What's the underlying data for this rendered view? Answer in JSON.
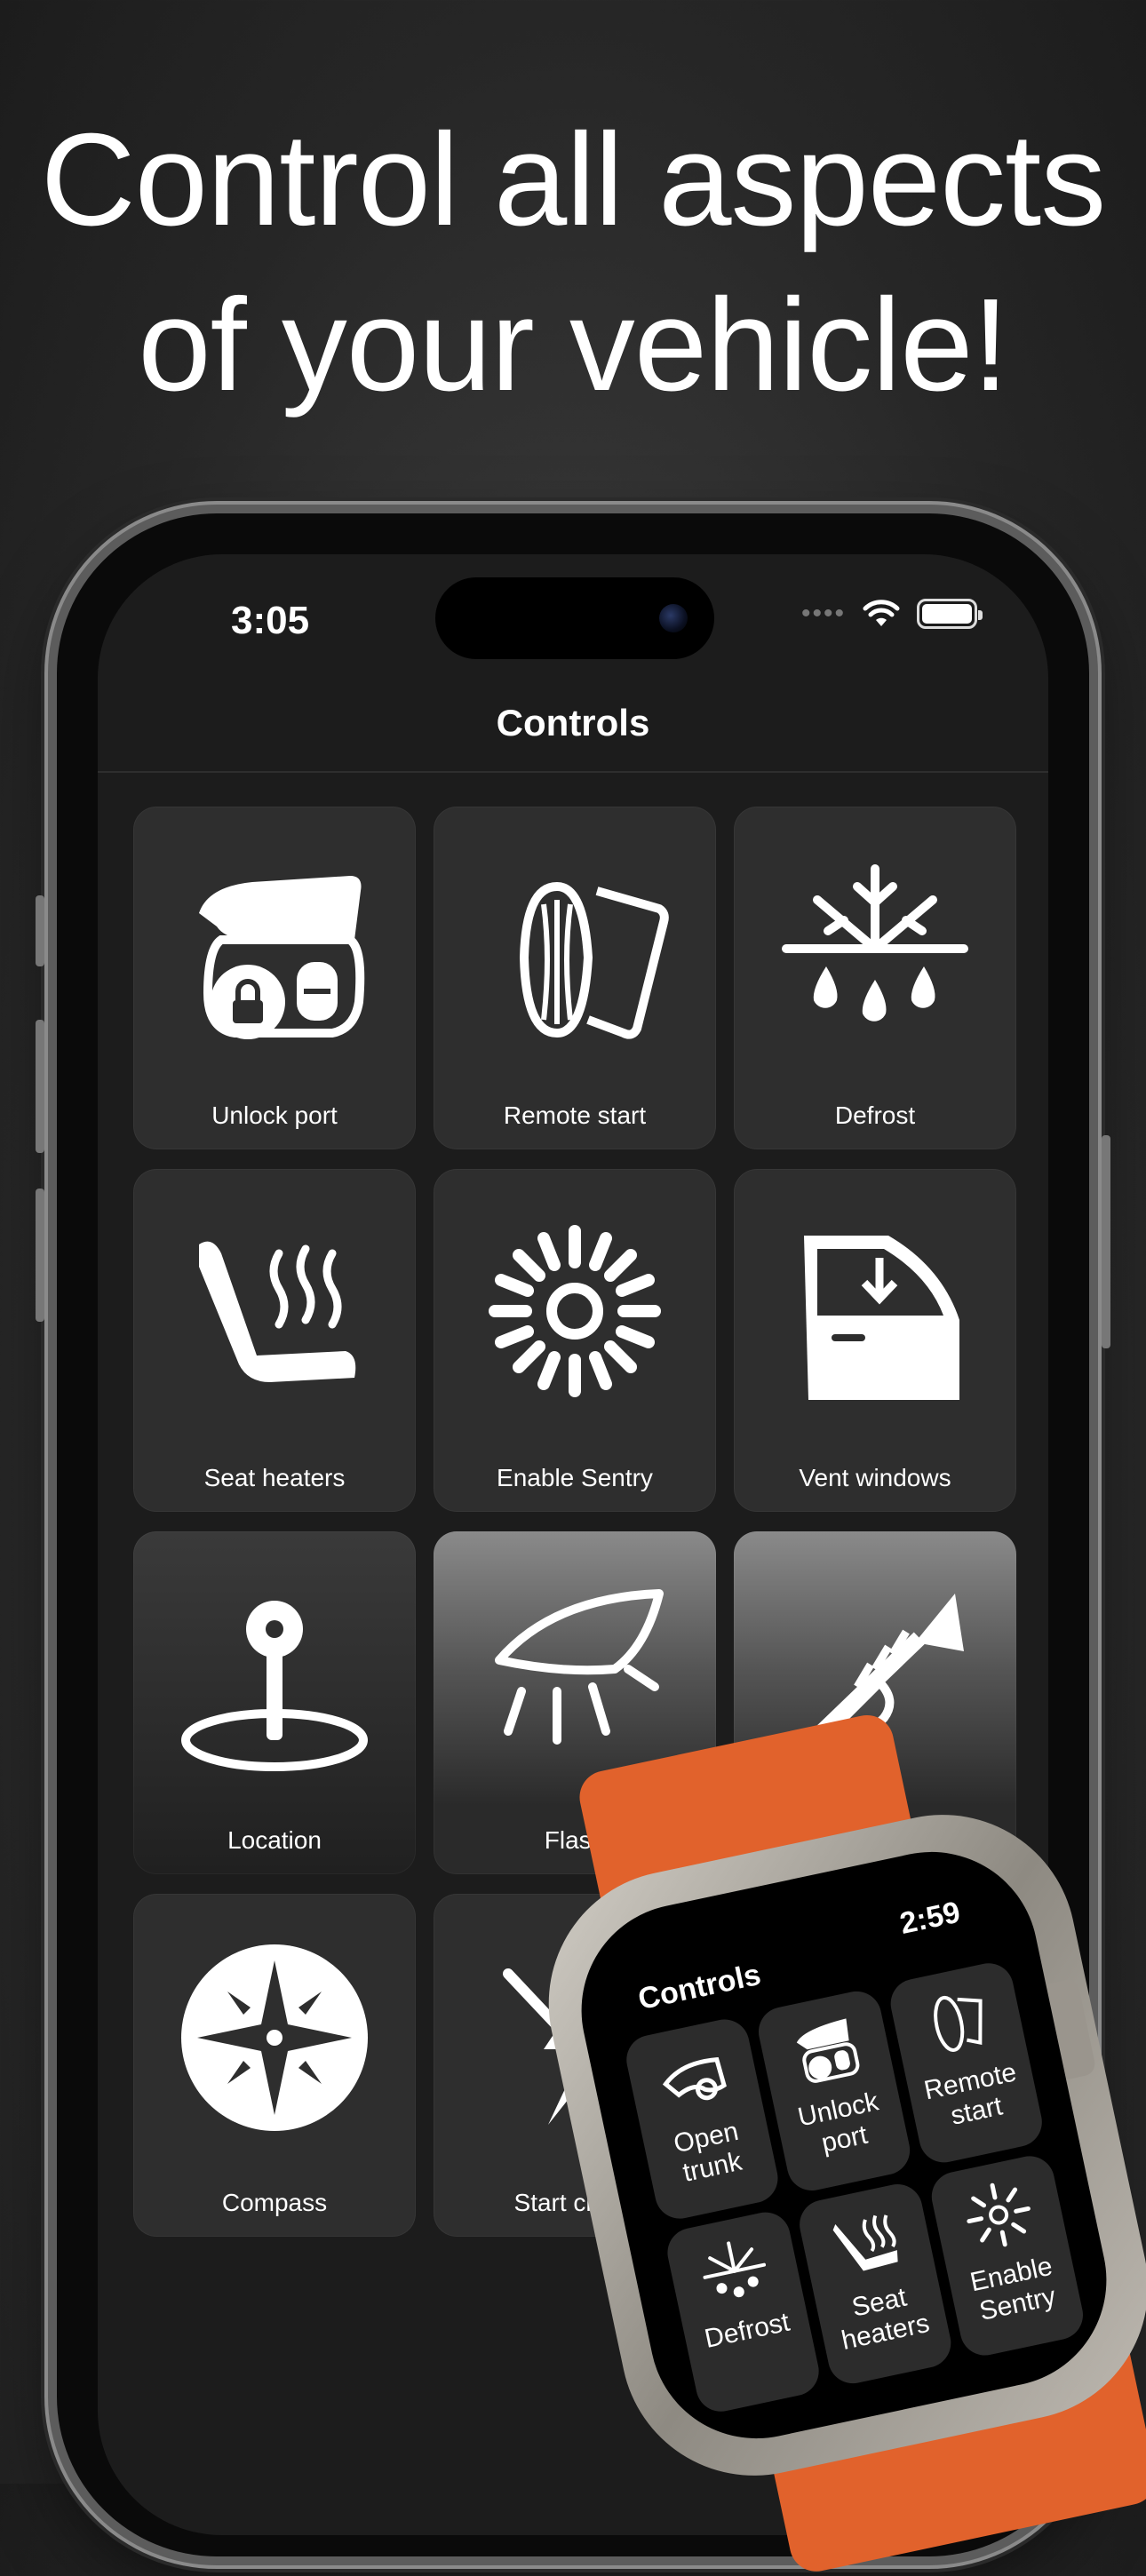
{
  "headline": {
    "line1": "Control all aspects",
    "line2": "of your vehicle!"
  },
  "phone": {
    "status": {
      "time": "3:05",
      "signal_icon": "cellular-dots-icon",
      "wifi_icon": "wifi-icon",
      "battery_icon": "battery-icon"
    },
    "nav": {
      "title": "Controls"
    },
    "tiles": [
      {
        "label": "Unlock port",
        "icon": "charge-port-lock-icon"
      },
      {
        "label": "Remote start",
        "icon": "remote-start-icon"
      },
      {
        "label": "Defrost",
        "icon": "defrost-icon"
      },
      {
        "label": "Seat heaters",
        "icon": "seat-heater-icon"
      },
      {
        "label": "Enable Sentry",
        "icon": "sentry-icon"
      },
      {
        "label": "Vent windows",
        "icon": "vent-window-icon"
      },
      {
        "label": "Location",
        "icon": "location-pin-icon"
      },
      {
        "label": "Flash",
        "icon": "headlight-flash-icon"
      },
      {
        "label": "",
        "icon": "horn-trumpet-icon"
      },
      {
        "label": "Compass",
        "icon": "compass-icon"
      },
      {
        "label": "Start charg",
        "icon": "charging-bolt-icon"
      }
    ]
  },
  "watch": {
    "title": "Controls",
    "time": "2:59",
    "tiles": [
      {
        "label": "Open trunk",
        "icon": "trunk-icon"
      },
      {
        "label": "Unlock port",
        "icon": "charge-port-lock-icon"
      },
      {
        "label": "Remote start",
        "icon": "remote-start-icon"
      },
      {
        "label": "Defrost",
        "icon": "defrost-icon"
      },
      {
        "label": "Seat heaters",
        "icon": "seat-heater-icon"
      },
      {
        "label": "Enable Sentry",
        "icon": "sentry-icon"
      }
    ]
  },
  "colors": {
    "band": "#e1622c",
    "tile": "#2e2e2e",
    "screen": "#1c1c1c"
  }
}
